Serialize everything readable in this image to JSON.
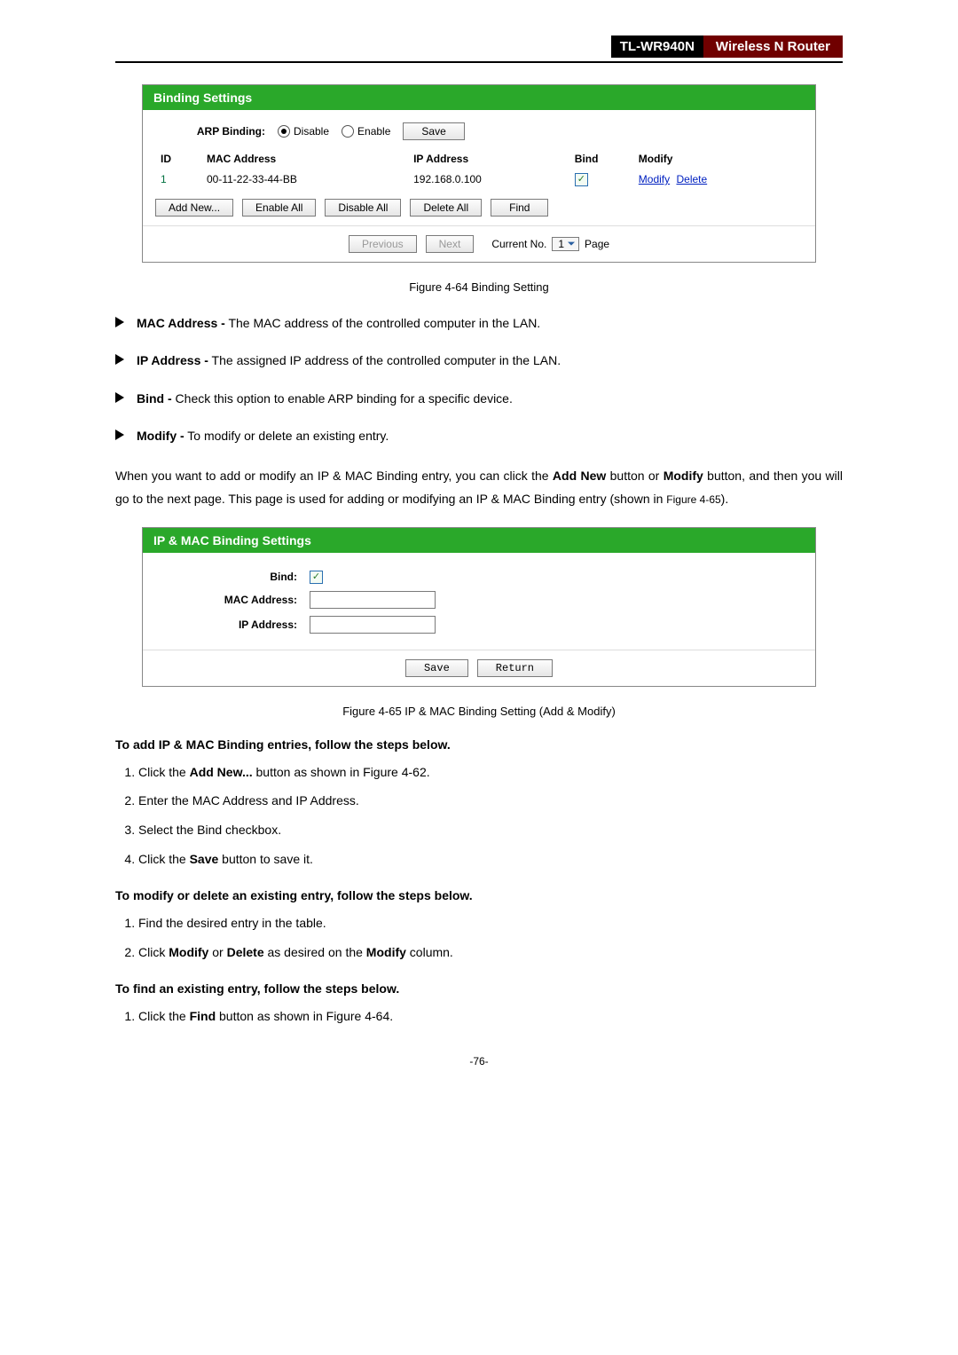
{
  "header": {
    "model": "TL-WR940N",
    "product": "Wireless  N  Router"
  },
  "panel1": {
    "title": "Binding Settings",
    "arp_label": "ARP Binding:",
    "opt_disable": "Disable",
    "opt_enable": "Enable",
    "save_btn": "Save",
    "cols": {
      "id": "ID",
      "mac": "MAC Address",
      "ip": "IP Address",
      "bind": "Bind",
      "modify": "Modify"
    },
    "row": {
      "id": "1",
      "mac": "00-11-22-33-44-BB",
      "ip": "192.168.0.100",
      "modify": "Modify",
      "delete": "Delete"
    },
    "btns": {
      "add": "Add New...",
      "enable": "Enable All",
      "disable": "Disable All",
      "delete": "Delete All",
      "find": "Find"
    },
    "footer": {
      "prev": "Previous",
      "next": "Next",
      "cur_label": "Current No.",
      "cur_val": "1",
      "page_label": "Page"
    }
  },
  "fig1": "Figure 4-64 Binding Setting",
  "bullets": [
    {
      "b": "MAC Address -",
      "t": " The MAC address of the controlled computer in the LAN."
    },
    {
      "b": "IP Address -",
      "t": " The assigned IP address of the controlled computer in the LAN."
    },
    {
      "b": "Bind -",
      "t": " Check this option to enable ARP binding for a specific device."
    },
    {
      "b": "Modify -",
      "t": " To modify or delete an existing entry."
    }
  ],
  "para": {
    "p1a": "When you want to add or modify an IP & MAC Binding entry, you can click the ",
    "p1b": "Add New",
    "p1c": " button or ",
    "p1d": "Modify",
    "p1e": " button, and then you will go to the next page. This page is used for adding or modifying an IP & MAC Binding entry (shown in ",
    "p1f": "Figure 4-65",
    "p1g": ")."
  },
  "panel2": {
    "title": "IP & MAC Binding Settings",
    "bind_label": "Bind:",
    "mac_label": "MAC Address:",
    "ip_label": "IP Address:",
    "save": "Save",
    "return": "Return"
  },
  "fig2": "Figure 4-65    IP & MAC Binding Setting (Add & Modify)",
  "sec_add": "To add IP & MAC Binding entries, follow the steps below.",
  "steps_add": [
    {
      "a": "Click the ",
      "b": "Add New...",
      "c": " button as shown in Figure 4-62."
    },
    {
      "a": "Enter the MAC Address and IP Address.",
      "b": "",
      "c": ""
    },
    {
      "a": "Select the Bind checkbox.",
      "b": "",
      "c": ""
    },
    {
      "a": "Click the ",
      "b": "Save",
      "c": " button to save it."
    }
  ],
  "sec_mod": "To modify or delete an existing entry, follow the steps below.",
  "steps_mod": [
    {
      "a": "Find the desired entry in the table.",
      "b": "",
      "c": "",
      "d": "",
      "e": ""
    },
    {
      "a": "Click ",
      "b": "Modify",
      "c": " or ",
      "d": "Delete",
      "e": " as desired on the ",
      "f": "Modify",
      "g": " column."
    }
  ],
  "sec_find": "To find an existing entry, follow the steps below.",
  "steps_find": [
    {
      "a": "Click the ",
      "b": "Find",
      "c": " button as shown in Figure 4-64."
    }
  ],
  "page_num": "-76-"
}
